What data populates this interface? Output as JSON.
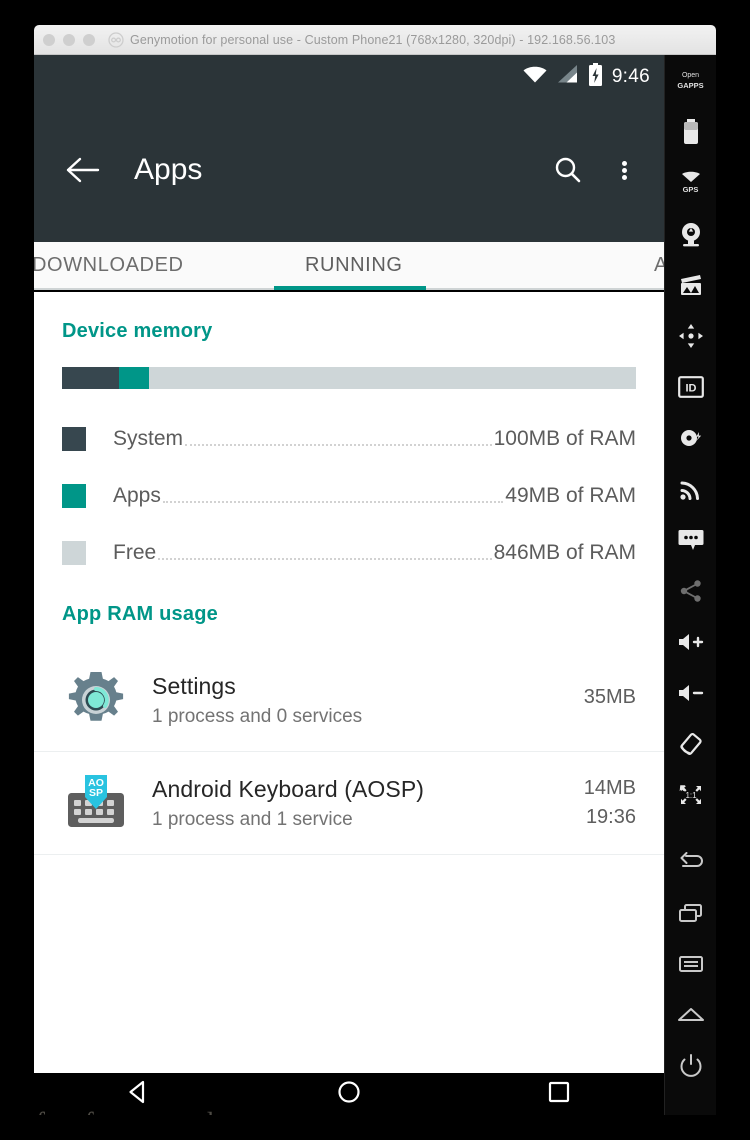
{
  "window": {
    "title": "Genymotion for personal use - Custom Phone21 (768x1280, 320dpi) - 192.168.56.103",
    "logo_icon": "genymotion-logo-icon",
    "controls": [
      "close-dot",
      "minimize-dot",
      "zoom-dot"
    ]
  },
  "statusbar": {
    "wifi_icon": "wifi-icon",
    "signal_icon": "cell-signal-icon",
    "battery_icon": "battery-charging-icon",
    "clock": "9:46"
  },
  "appbar": {
    "back_icon": "back-arrow-icon",
    "title": "Apps",
    "search_icon": "search-icon",
    "overflow_icon": "overflow-menu-icon"
  },
  "tabs": {
    "items": [
      {
        "label": "DOWNLOADED",
        "selected": false
      },
      {
        "label": "RUNNING",
        "selected": true
      },
      {
        "label": "ALL",
        "selected": false
      }
    ],
    "indicator_color": "#009688"
  },
  "device_memory": {
    "heading": "Device memory",
    "bar": {
      "system_pct": 10.0,
      "apps_pct": 5.2,
      "free_pct": 84.8
    },
    "legend": [
      {
        "label": "System",
        "value": "100MB of RAM",
        "color": "#37474f",
        "swatch_icon": "system-color-swatch"
      },
      {
        "label": "Apps",
        "value": "49MB of RAM",
        "color": "#009688",
        "swatch_icon": "apps-color-swatch"
      },
      {
        "label": "Free",
        "value": "846MB of RAM",
        "color": "#ced6d8",
        "swatch_icon": "free-color-swatch"
      }
    ]
  },
  "app_ram_usage": {
    "heading": "App RAM usage",
    "items": [
      {
        "icon": "settings-gear-icon",
        "name": "Settings",
        "subtitle": "1 process and 0 services",
        "size": "35MB",
        "time": ""
      },
      {
        "icon": "android-keyboard-aosp-icon",
        "icon_badge_text": "AOSP",
        "name": "Android Keyboard (AOSP)",
        "subtitle": "1 process and 1 service",
        "size": "14MB",
        "time": "19:36"
      }
    ]
  },
  "navbar": {
    "back_icon": "nav-back-triangle-icon",
    "home_icon": "nav-home-circle-icon",
    "recents_icon": "nav-recents-square-icon"
  },
  "watermark": "free for personal use",
  "toolbar": {
    "items": [
      {
        "icon": "opengapps-icon",
        "label": "Open",
        "sublabel": "GAPPS",
        "dim": false
      },
      {
        "icon": "battery-icon",
        "label": "",
        "sublabel": "",
        "dim": false
      },
      {
        "icon": "gps-icon",
        "label": "",
        "sublabel": "GPS",
        "dim": false
      },
      {
        "icon": "camera-icon",
        "label": "",
        "sublabel": "",
        "dim": false
      },
      {
        "icon": "screencast-icon",
        "label": "",
        "sublabel": "",
        "dim": false
      },
      {
        "icon": "dpad-icon",
        "label": "",
        "sublabel": "",
        "dim": false
      },
      {
        "icon": "identifiers-icon",
        "label": "",
        "sublabel": "",
        "dim": false
      },
      {
        "icon": "disk-io-icon",
        "label": "",
        "sublabel": "",
        "dim": false
      },
      {
        "icon": "network-icon",
        "label": "",
        "sublabel": "",
        "dim": false
      },
      {
        "icon": "sms-icon",
        "label": "",
        "sublabel": "",
        "dim": false
      },
      {
        "icon": "share-icon",
        "label": "",
        "sublabel": "",
        "dim": true
      },
      {
        "icon": "volume-up-icon",
        "label": "",
        "sublabel": "",
        "dim": false
      },
      {
        "icon": "volume-down-icon",
        "label": "",
        "sublabel": "",
        "dim": false
      },
      {
        "icon": "rotate-icon",
        "label": "",
        "sublabel": "",
        "dim": false
      },
      {
        "icon": "fullscreen-1to1-icon",
        "label": "",
        "sublabel": "",
        "dim": false
      },
      {
        "icon": "back-icon",
        "label": "",
        "sublabel": "",
        "dim": false
      },
      {
        "icon": "recents-icon",
        "label": "",
        "sublabel": "",
        "dim": false
      },
      {
        "icon": "menu-icon",
        "label": "",
        "sublabel": "",
        "dim": false
      },
      {
        "icon": "home-icon",
        "label": "",
        "sublabel": "",
        "dim": false
      },
      {
        "icon": "power-icon",
        "label": "",
        "sublabel": "",
        "dim": false
      }
    ]
  }
}
